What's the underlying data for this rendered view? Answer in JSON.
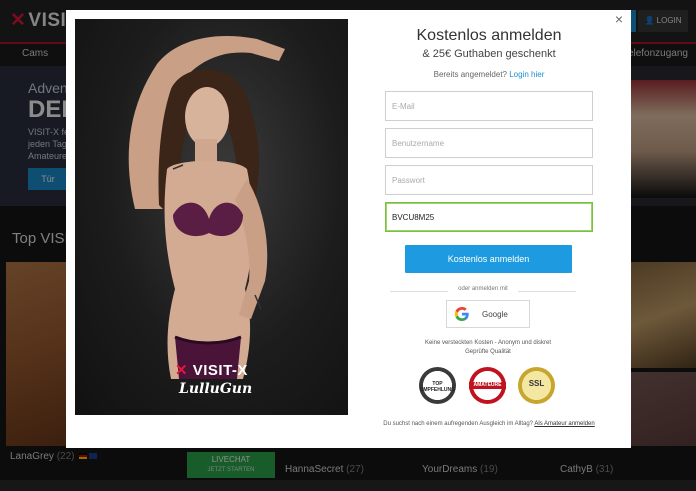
{
  "background": {
    "logo": "VISIT-X",
    "login_button": "LOGIN",
    "nav_left": "Cams",
    "nav_right": "Telefonzugang",
    "hero": {
      "title": "Advent",
      "big": "DEIN",
      "text": "VISIT-X fei jeden Tag Amateure",
      "button": "Tür"
    },
    "section_title": "Top VISIT",
    "tiles": [
      {
        "name": "LanaGrey",
        "age": "(22)"
      },
      {
        "name": "HannaSecret",
        "age": "(27)"
      },
      {
        "name": "YourDreams",
        "age": "(19)"
      },
      {
        "name": "CathyB",
        "age": "(31)"
      }
    ],
    "live_badge": {
      "label": "LIVECHAT",
      "sub": "JETZT STARTEN"
    }
  },
  "modal": {
    "close_label": "×",
    "promo": {
      "logo": "VISIT-X",
      "signature": "LulluGun"
    },
    "title": "Kostenlos anmelden",
    "subtitle": "& 25€ Guthaben geschenkt",
    "already_text": "Bereits angemeldet?",
    "login_link": "Login hier",
    "fields": {
      "email_placeholder": "E-Mail",
      "username_placeholder": "Benutzername",
      "password_placeholder": "Passwort",
      "code_value": "BVCU8M25"
    },
    "submit_label": "Kostenlos anmelden",
    "or_text": "oder anmelden mit",
    "google_label": "Google",
    "note_line1": "Keine versteckten Kosten - Anonym und diskret",
    "note_line2": "Geprüfte Qualität",
    "badges": {
      "top": "TOP EMPFEHLUNG",
      "amateure": "AMATEURE",
      "ssl": "SSL"
    },
    "footer_text": "Du suchst nach einem aufregenden Ausgleich im Alltag?",
    "footer_link": "Als Amateur anmelden"
  },
  "colors": {
    "accent_blue": "#1e9be0",
    "brand_red": "#e0173a",
    "valid_green": "#7ac143"
  }
}
